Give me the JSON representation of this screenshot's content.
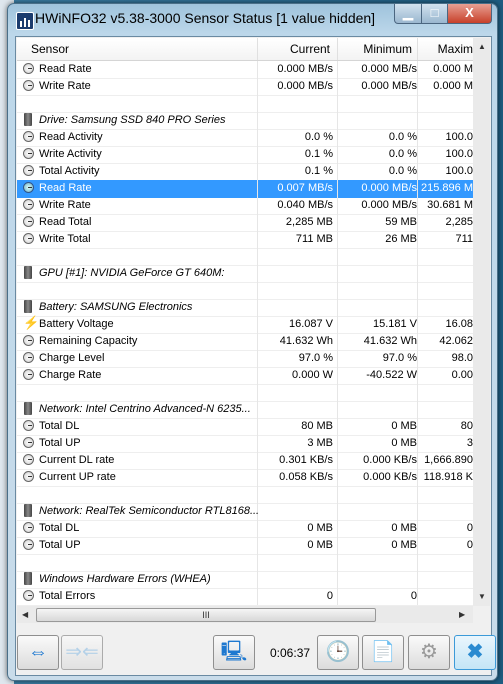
{
  "window": {
    "title": "HWiNFO32 v5.38-3000 Sensor Status [1 value hidden]",
    "minimize": "▁",
    "maximize": "□",
    "close": "X"
  },
  "columns": [
    "Sensor",
    "Current",
    "Minimum",
    "Maxim"
  ],
  "rows": [
    {
      "type": "sensor",
      "icon": "clock",
      "label": "Read Rate",
      "current": "0.000 MB/s",
      "minimum": "0.000 MB/s",
      "maximum": "0.000 M"
    },
    {
      "type": "sensor",
      "icon": "clock",
      "label": "Write Rate",
      "current": "0.000 MB/s",
      "minimum": "0.000 MB/s",
      "maximum": "0.000 M"
    },
    {
      "type": "blank"
    },
    {
      "type": "header",
      "icon": "chip",
      "label": "Drive: Samsung SSD 840 PRO Series"
    },
    {
      "type": "sensor",
      "icon": "clock",
      "label": "Read Activity",
      "current": "0.0 %",
      "minimum": "0.0 %",
      "maximum": "100.0"
    },
    {
      "type": "sensor",
      "icon": "clock",
      "label": "Write Activity",
      "current": "0.1 %",
      "minimum": "0.0 %",
      "maximum": "100.0"
    },
    {
      "type": "sensor",
      "icon": "clock",
      "label": "Total Activity",
      "current": "0.1 %",
      "minimum": "0.0 %",
      "maximum": "100.0"
    },
    {
      "type": "sensor",
      "icon": "clock",
      "label": "Read Rate",
      "current": "0.007 MB/s",
      "minimum": "0.000 MB/s",
      "maximum": "215.896 M",
      "selected": true
    },
    {
      "type": "sensor",
      "icon": "clock",
      "label": "Write Rate",
      "current": "0.040 MB/s",
      "minimum": "0.000 MB/s",
      "maximum": "30.681 M"
    },
    {
      "type": "sensor",
      "icon": "clock",
      "label": "Read Total",
      "current": "2,285 MB",
      "minimum": "59 MB",
      "maximum": "2,285"
    },
    {
      "type": "sensor",
      "icon": "clock",
      "label": "Write Total",
      "current": "711 MB",
      "minimum": "26 MB",
      "maximum": "711"
    },
    {
      "type": "blank"
    },
    {
      "type": "header",
      "icon": "chip",
      "label": "GPU [#1]: NVIDIA GeForce GT 640M:"
    },
    {
      "type": "blank"
    },
    {
      "type": "header",
      "icon": "chip",
      "label": "Battery: SAMSUNG Electronics"
    },
    {
      "type": "sensor",
      "icon": "bolt",
      "label": "Battery Voltage",
      "current": "16.087 V",
      "minimum": "15.181 V",
      "maximum": "16.08"
    },
    {
      "type": "sensor",
      "icon": "clock",
      "label": "Remaining Capacity",
      "current": "41.632 Wh",
      "minimum": "41.632 Wh",
      "maximum": "42.062"
    },
    {
      "type": "sensor",
      "icon": "clock",
      "label": "Charge Level",
      "current": "97.0 %",
      "minimum": "97.0 %",
      "maximum": "98.0"
    },
    {
      "type": "sensor",
      "icon": "clock",
      "label": "Charge Rate",
      "current": "0.000 W",
      "minimum": "-40.522 W",
      "maximum": "0.00"
    },
    {
      "type": "blank"
    },
    {
      "type": "header",
      "icon": "chip",
      "label": "Network: Intel Centrino Advanced-N 6235..."
    },
    {
      "type": "sensor",
      "icon": "clock",
      "label": "Total DL",
      "current": "80 MB",
      "minimum": "0 MB",
      "maximum": "80"
    },
    {
      "type": "sensor",
      "icon": "clock",
      "label": "Total UP",
      "current": "3 MB",
      "minimum": "0 MB",
      "maximum": "3"
    },
    {
      "type": "sensor",
      "icon": "clock",
      "label": "Current DL rate",
      "current": "0.301 KB/s",
      "minimum": "0.000 KB/s",
      "maximum": "1,666.890"
    },
    {
      "type": "sensor",
      "icon": "clock",
      "label": "Current UP rate",
      "current": "0.058 KB/s",
      "minimum": "0.000 KB/s",
      "maximum": "118.918 K"
    },
    {
      "type": "blank"
    },
    {
      "type": "header",
      "icon": "chip",
      "label": "Network: RealTek Semiconductor RTL8168..."
    },
    {
      "type": "sensor",
      "icon": "clock",
      "label": "Total DL",
      "current": "0 MB",
      "minimum": "0 MB",
      "maximum": "0"
    },
    {
      "type": "sensor",
      "icon": "clock",
      "label": "Total UP",
      "current": "0 MB",
      "minimum": "0 MB",
      "maximum": "0"
    },
    {
      "type": "blank"
    },
    {
      "type": "header",
      "icon": "chip",
      "label": "Windows Hardware Errors (WHEA)"
    },
    {
      "type": "sensor",
      "icon": "clock",
      "label": "Total Errors",
      "current": "0",
      "minimum": "0",
      "maximum": ""
    }
  ],
  "scrollbar": {
    "thumb_grip": "III"
  },
  "toolbar": {
    "elapsed": "0:06:37",
    "icons": [
      "expand-arrows",
      "collapse-arrows",
      "network-computers",
      "clock",
      "add-report",
      "settings-gear",
      "close-x"
    ]
  },
  "colors": {
    "selection": "#3399ff",
    "accent": "#1e78d0"
  }
}
